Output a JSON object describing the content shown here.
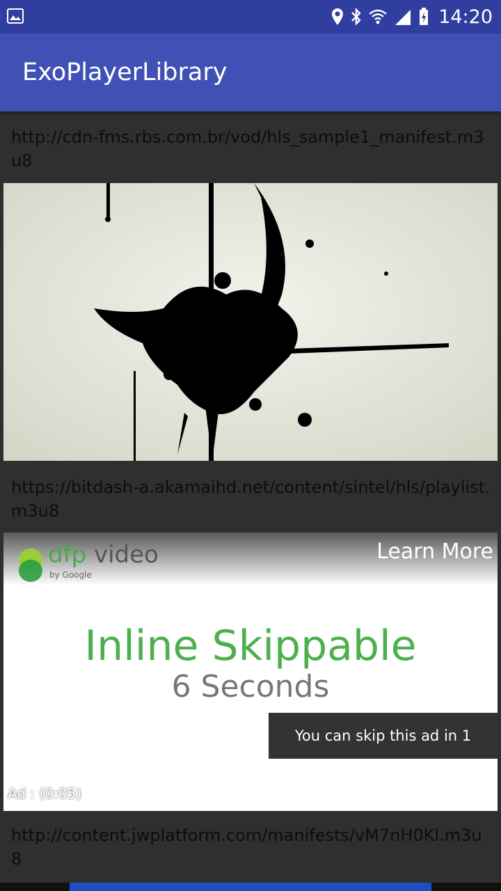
{
  "status_bar": {
    "time": "14:20",
    "icons": [
      "image-icon",
      "location-icon",
      "bluetooth-icon",
      "wifi-icon",
      "signal-icon",
      "battery-icon"
    ]
  },
  "app_bar": {
    "title": "ExoPlayerLibrary"
  },
  "items": [
    {
      "url": "http://cdn-fms.rbs.com.br/vod/hls_sample1_manifest.m3u8"
    },
    {
      "url": "https://bitdash-a.akamaihd.net/content/sintel/hls/playlist.m3u8"
    },
    {
      "url": "http://content.jwplatform.com/manifests/vM7nH0Kl.m3u8"
    }
  ],
  "ad": {
    "brand": "dfp",
    "brand_suffix": " video",
    "by": "by Google",
    "learn_more": "Learn More",
    "title": "Inline Skippable",
    "subtitle": "6 Seconds",
    "skip_text": "You can skip this ad in 1",
    "timer": "Ad : (0:05)"
  },
  "colors": {
    "status_bar": "#303f9f",
    "app_bar": "#3f51b5",
    "background": "#2f2f2f",
    "ad_green": "#4cb04c"
  }
}
